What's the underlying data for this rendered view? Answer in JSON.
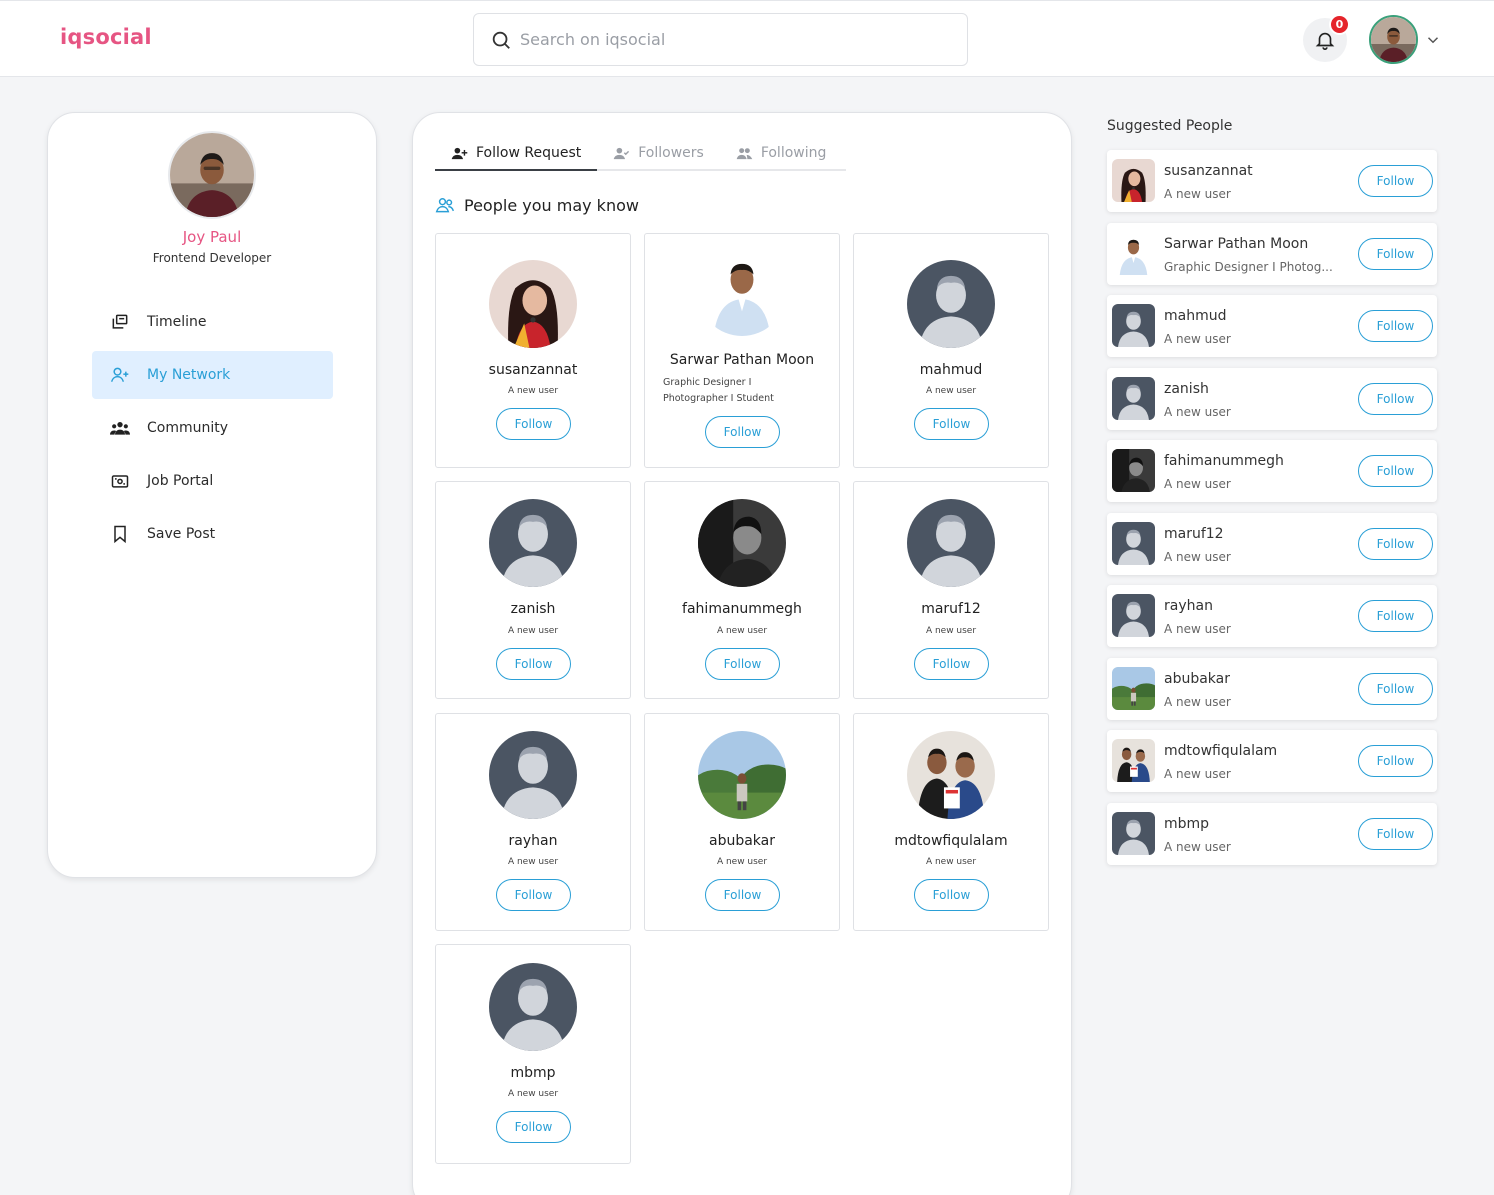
{
  "header": {
    "logo": "iqsocial",
    "search_placeholder": "Search on iqsocial",
    "notification_count": "0"
  },
  "profile": {
    "name": "Joy Paul",
    "role": "Frontend Developer"
  },
  "nav": [
    {
      "label": "Timeline",
      "icon": "timeline-icon"
    },
    {
      "label": "My Network",
      "icon": "add-user-icon",
      "active": true
    },
    {
      "label": "Community",
      "icon": "community-icon"
    },
    {
      "label": "Job Portal",
      "icon": "job-portal-icon"
    },
    {
      "label": "Save Post",
      "icon": "bookmark-icon"
    }
  ],
  "tabs": [
    {
      "label": "Follow Request",
      "active": true
    },
    {
      "label": "Followers"
    },
    {
      "label": "Following"
    }
  ],
  "section_title": "People you may know",
  "follow_label": "Follow",
  "people": [
    {
      "name": "susanzannat",
      "sub": "A new user"
    },
    {
      "name": "Sarwar Pathan Moon",
      "sub": "Graphic Designer I Photographer I Student"
    },
    {
      "name": "mahmud",
      "sub": "A new user"
    },
    {
      "name": "zanish",
      "sub": "A new user"
    },
    {
      "name": "fahimanummegh",
      "sub": "A new user"
    },
    {
      "name": "maruf12",
      "sub": "A new user"
    },
    {
      "name": "rayhan",
      "sub": "A new user"
    },
    {
      "name": "abubakar",
      "sub": "A new user"
    },
    {
      "name": "mdtowfiqulalam",
      "sub": "A new user"
    },
    {
      "name": "mbmp",
      "sub": "A new user"
    }
  ],
  "suggested": {
    "title": "Suggested People",
    "items": [
      {
        "name": "susanzannat",
        "sub": "A new user"
      },
      {
        "name": "Sarwar Pathan Moon",
        "sub": "Graphic Designer I Photog..."
      },
      {
        "name": "mahmud",
        "sub": "A new user"
      },
      {
        "name": "zanish",
        "sub": "A new user"
      },
      {
        "name": "fahimanummegh",
        "sub": "A new user"
      },
      {
        "name": "maruf12",
        "sub": "A new user"
      },
      {
        "name": "rayhan",
        "sub": "A new user"
      },
      {
        "name": "abubakar",
        "sub": "A new user"
      },
      {
        "name": "mdtowfiqulalam",
        "sub": "A new user"
      },
      {
        "name": "mbmp",
        "sub": "A new user"
      }
    ]
  },
  "colors": {
    "brand": "#e65583",
    "accent": "#2a9fd6",
    "active_nav_bg": "#e0efff",
    "badge": "#e5242b"
  }
}
